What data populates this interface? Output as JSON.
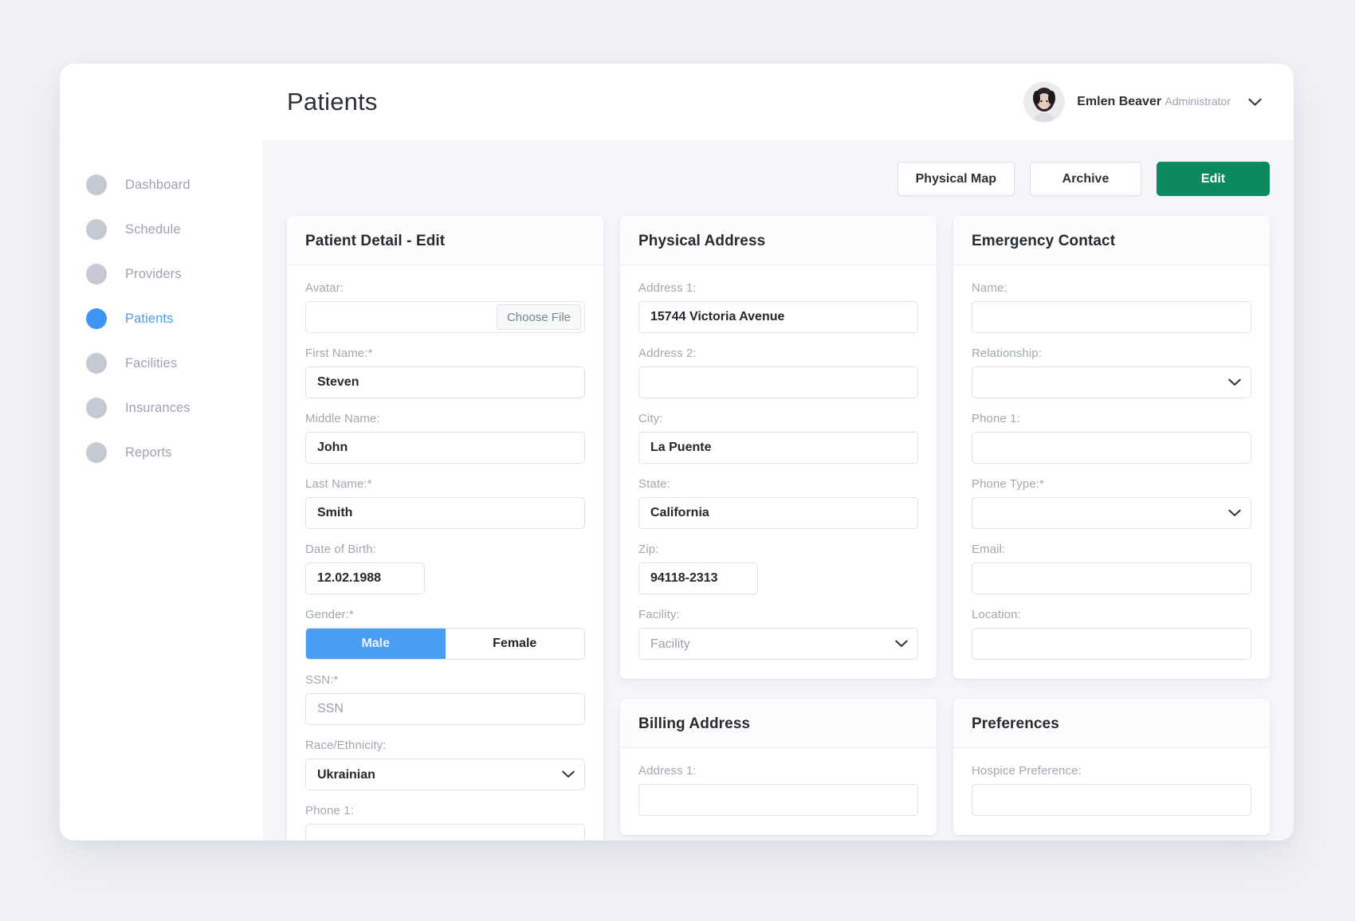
{
  "header": {
    "title": "Patients",
    "user": {
      "name": "Emlen Beaver",
      "role": "Administrator",
      "chevron_icon": "chevron-down-icon",
      "avatar_icon": "avatar"
    }
  },
  "sidebar": {
    "items": [
      {
        "label": "Dashboard",
        "active": false
      },
      {
        "label": "Schedule",
        "active": false
      },
      {
        "label": "Providers",
        "active": false
      },
      {
        "label": "Patients",
        "active": true
      },
      {
        "label": "Facilities",
        "active": false
      },
      {
        "label": "Insurances",
        "active": false
      },
      {
        "label": "Reports",
        "active": false
      }
    ]
  },
  "actions": {
    "physical_map": "Physical Map",
    "archive": "Archive",
    "edit": "Edit"
  },
  "colors": {
    "accent_blue": "#4a9df2",
    "accent_green": "#0b8a5e",
    "page_background": "#f1f2f6",
    "panel_background": "#f5f6f9",
    "label_grey": "#a3a7b1"
  },
  "cards": {
    "patient_detail": {
      "title": "Patient Detail - Edit",
      "labels": {
        "avatar": "Avatar:",
        "first_name": "First Name:*",
        "middle_name": "Middle Name:",
        "last_name": "Last Name:*",
        "dob": "Date of Birth:",
        "gender": "Gender:*",
        "ssn": "SSN:*",
        "race": "Race/Ethnicity:",
        "phone1": "Phone 1:"
      },
      "values": {
        "avatar_file": "",
        "choose_file": "Choose File",
        "first_name": "Steven",
        "middle_name": "John",
        "last_name": "Smith",
        "dob": "12.02.1988",
        "ssn": "",
        "ssn_placeholder": "SSN",
        "race": "Ukrainian"
      },
      "gender_options": [
        "Male",
        "Female"
      ],
      "gender_selected": "Male"
    },
    "physical_address": {
      "title": "Physical Address",
      "labels": {
        "address1": "Address 1:",
        "address2": "Address 2:",
        "city": "City:",
        "state": "State:",
        "zip": "Zip:",
        "facility": "Facility:"
      },
      "values": {
        "address1": "15744 Victoria Avenue",
        "address2": "",
        "city": "La Puente",
        "state": "California",
        "zip": "94118-2313",
        "facility": "",
        "facility_placeholder": "Facility"
      }
    },
    "emergency_contact": {
      "title": "Emergency Contact",
      "labels": {
        "name": "Name:",
        "relationship": "Relationship:",
        "phone1": "Phone 1:",
        "phone_type": "Phone Type:*",
        "email": "Email:",
        "location": "Location:"
      },
      "values": {
        "name": "",
        "relationship": "",
        "phone1": "",
        "phone_type": "",
        "email": "",
        "location": ""
      }
    },
    "billing_address": {
      "title": "Billing Address",
      "labels": {
        "address1": "Address 1:"
      },
      "values": {
        "address1": ""
      }
    },
    "preferences": {
      "title": "Preferences",
      "labels": {
        "hospice_preference": "Hospice Preference:"
      },
      "values": {
        "hospice_preference": ""
      }
    }
  }
}
